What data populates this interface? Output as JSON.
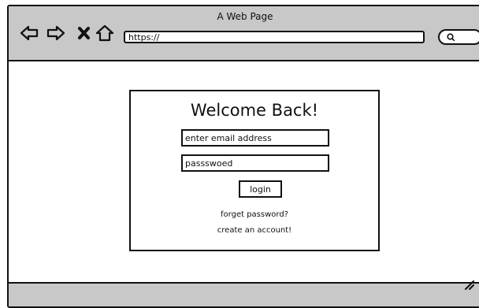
{
  "window": {
    "title": "A Web Page"
  },
  "toolbar": {
    "back_icon": "arrow-left-icon",
    "forward_icon": "arrow-right-icon",
    "stop_icon": "close-icon",
    "home_icon": "home-icon",
    "url": "https://",
    "search_icon": "search-icon"
  },
  "login": {
    "heading": "Welcome Back!",
    "email_placeholder": "enter email address",
    "password_value": "passswoed",
    "login_label": "login",
    "forgot_link": "forget password?",
    "create_link": "create an account!"
  },
  "status_bar": {
    "resize_icon": "resize-grip-icon"
  }
}
